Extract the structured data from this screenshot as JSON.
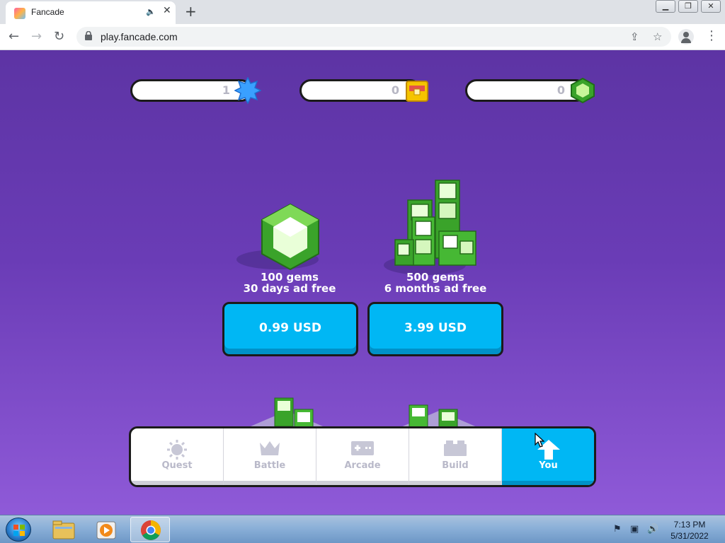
{
  "browser": {
    "tab_title": "Fancade",
    "tab_audio_icon": "speaker-icon",
    "tab_close": "✕",
    "new_tab": "+",
    "window_controls": [
      "▁",
      "❐",
      "✕"
    ],
    "url": "play.fancade.com"
  },
  "counters": [
    {
      "name": "stars",
      "value": "1",
      "icon": "star-icon",
      "color": "#3aa0ff"
    },
    {
      "name": "chests",
      "value": "0",
      "icon": "chest-icon",
      "color": "#f5c400"
    },
    {
      "name": "gems",
      "value": "0",
      "icon": "gem-icon",
      "color": "#4cc433"
    }
  ],
  "offers": [
    {
      "line1": "100 gems",
      "line2": "30 days ad free",
      "price": "0.99 USD"
    },
    {
      "line1": "500 gems",
      "line2": "6 months ad free",
      "price": "3.99 USD"
    }
  ],
  "bottom_nav": [
    {
      "label": "Quest",
      "icon": "sun-icon",
      "active": false
    },
    {
      "label": "Battle",
      "icon": "crown-icon",
      "active": false
    },
    {
      "label": "Arcade",
      "icon": "gamepad-icon",
      "active": false
    },
    {
      "label": "Build",
      "icon": "brick-icon",
      "active": false
    },
    {
      "label": "You",
      "icon": "arrow-up-icon",
      "active": true
    }
  ],
  "colors": {
    "accent": "#00b7f4",
    "bg_top": "#5d34a4",
    "bg_bottom": "#8f5ad8",
    "gem_green": "#4cc433"
  },
  "taskbar": {
    "time": "7:13 PM",
    "date": "5/31/2022"
  }
}
